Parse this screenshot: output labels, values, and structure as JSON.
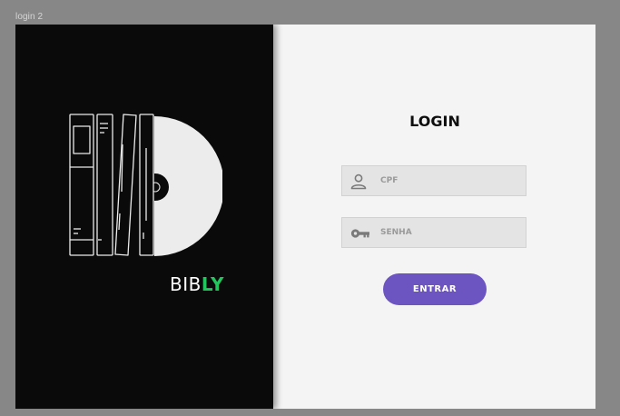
{
  "frame": {
    "title": "login 2"
  },
  "brand": {
    "prefix": "BIB",
    "accent": "LY",
    "accent_color": "#22c55e"
  },
  "illustration": {
    "icon": "books-and-disc-icon"
  },
  "login": {
    "title": "LOGIN",
    "cpf": {
      "placeholder": "CPF",
      "value": "",
      "icon": "user-icon"
    },
    "password": {
      "placeholder": "SENHA",
      "value": "",
      "icon": "key-icon"
    },
    "submit_label": "ENTRAR",
    "submit_color": "#6d55c1"
  },
  "colors": {
    "canvas": "#888787",
    "left_panel": "#0b0a0b",
    "right_panel": "#f4f4f4",
    "field_bg": "#e4e4e4"
  }
}
